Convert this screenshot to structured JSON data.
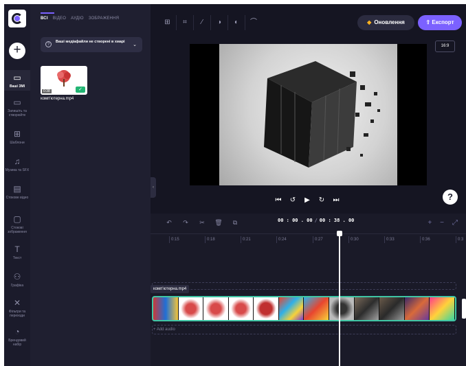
{
  "colors": {
    "accent": "#7b61ff",
    "upgrade_gem": "#ffb21e",
    "clip_border": "#3fc6a5",
    "check": "#22b573"
  },
  "rail": {
    "add_icon": "plus-icon",
    "items": [
      {
        "icon": "folder-icon",
        "label": "Ваші ЗМІ",
        "active": true
      },
      {
        "icon": "camera-icon",
        "label": "Запишіть та створюйте"
      },
      {
        "icon": "template-icon",
        "label": "Шаблони"
      },
      {
        "icon": "music-icon",
        "label": "Музика та SFX"
      },
      {
        "icon": "film-icon",
        "label": "Стокове відео"
      },
      {
        "icon": "image-icon",
        "label": "Стокові зображення"
      },
      {
        "icon": "text-icon",
        "label": "Текст"
      },
      {
        "icon": "graphics-icon",
        "label": "Графіка"
      },
      {
        "icon": "transition-icon",
        "label": "Фільтри та переходи"
      },
      {
        "icon": "brand-icon",
        "label": "Брендовий набір"
      }
    ]
  },
  "media": {
    "tabs": [
      "ВСІ",
      "ВІДЕО",
      "АУДІО",
      "ЗОБРАЖЕННЯ"
    ],
    "notice": "Ваші медіафайли не створені в хмарі",
    "file": {
      "name": "комп'ютерна.mp4",
      "duration": "0:38"
    }
  },
  "toolbar": {
    "upgrade_label": "Оновлення",
    "export_label": "Експорт",
    "ratio": "16:9"
  },
  "timeline": {
    "time_current": "00 : 00 . 00",
    "time_total": "00 : 38 . 00",
    "ticks": [
      "0:15",
      "0:18",
      "0:21",
      "0:24",
      "0:27",
      "0:30",
      "0:33",
      "0:36",
      "0:3"
    ],
    "clip_label": "комп'ютерна.mp4",
    "audio_label": "+ Add audio"
  }
}
